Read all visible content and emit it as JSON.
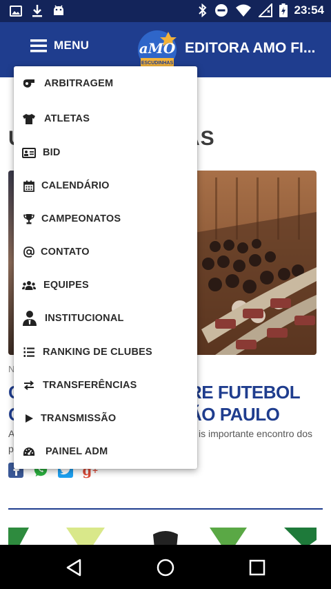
{
  "status_bar": {
    "time": "23:54",
    "left_icons": [
      "image-icon",
      "download-icon",
      "android-icon"
    ],
    "right_icons": [
      "bluetooth-icon",
      "do-not-disturb-icon",
      "wifi-icon",
      "no-signal-icon",
      "battery-charging-icon"
    ]
  },
  "header": {
    "menu_label": "MENU",
    "site_title": "EDITORA AMO FI...",
    "logo_text": "aMO",
    "logo_subtext": "ESCUDINHAS",
    "background": "#1f3d8e"
  },
  "content": {
    "section_heading_start": "U",
    "section_heading_end": "AS",
    "news_category": "N",
    "news_title_line1_start": "C",
    "news_title_line1_end": "RE FUTEBOL",
    "news_title_line2_start": "C",
    "news_title_line2_end": "ÃO PAULO",
    "news_excerpt_line1_start": "A",
    "news_excerpt_line1_end": "is importante encontro dos",
    "news_excerpt_line2_start": "p",
    "share_icons": [
      "facebook-icon",
      "whatsapp-icon",
      "twitter-icon",
      "google-plus-icon"
    ]
  },
  "menu": {
    "items": [
      {
        "label": "ARBITRAGEM",
        "icon": "whistle-icon"
      },
      {
        "label": "ATLETAS",
        "icon": "tshirt-icon"
      },
      {
        "label": "BID",
        "icon": "id-card-icon"
      },
      {
        "label": "CALENDÁRIO",
        "icon": "calendar-icon"
      },
      {
        "label": "CAMPEONATOS",
        "icon": "trophy-icon"
      },
      {
        "label": "CONTATO",
        "icon": "at-icon"
      },
      {
        "label": "EQUIPES",
        "icon": "users-icon"
      },
      {
        "label": "INSTITUCIONAL",
        "icon": "user-tie-icon"
      },
      {
        "label": "RANKING DE CLUBES",
        "icon": "list-ol-icon"
      },
      {
        "label": "TRANSFERÊNCIAS",
        "icon": "exchange-icon"
      },
      {
        "label": "TRANSMISSÃO",
        "icon": "play-icon"
      },
      {
        "label": "PAINEL ADM",
        "icon": "dashboard-icon"
      }
    ]
  },
  "nav_bar": {
    "buttons": [
      "back-icon",
      "home-icon",
      "recents-icon"
    ]
  }
}
